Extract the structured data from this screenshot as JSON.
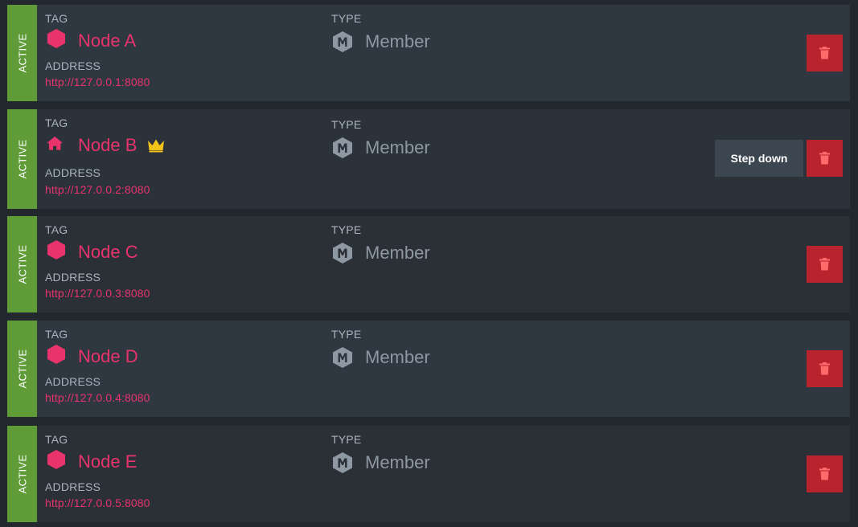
{
  "labels": {
    "tag": "TAG",
    "type": "TYPE",
    "address": "ADDRESS"
  },
  "nodes": [
    {
      "state": "ACTIVE",
      "tag_icon": "hexagon-icon",
      "name": "Node A",
      "leader": false,
      "type": "Member",
      "type_icon": "member-hexagon-icon",
      "address": "http://127.0.0.1:8080"
    },
    {
      "state": "ACTIVE",
      "tag_icon": "home-icon",
      "name": "Node B",
      "leader": true,
      "leader_icon": "crown-icon",
      "type": "Member",
      "type_icon": "member-hexagon-icon",
      "address": "http://127.0.0.2:8080",
      "step_down_label": "Step down"
    },
    {
      "state": "ACTIVE",
      "tag_icon": "hexagon-icon",
      "name": "Node C",
      "leader": false,
      "type": "Member",
      "type_icon": "member-hexagon-icon",
      "address": "http://127.0.0.3:8080"
    },
    {
      "state": "ACTIVE",
      "tag_icon": "hexagon-icon",
      "name": "Node D",
      "leader": false,
      "type": "Member",
      "type_icon": "member-hexagon-icon",
      "address": "http://127.0.0.4:8080"
    },
    {
      "state": "ACTIVE",
      "tag_icon": "hexagon-icon",
      "name": "Node E",
      "leader": false,
      "type": "Member",
      "type_icon": "member-hexagon-icon",
      "address": "http://127.0.0.5:8080"
    }
  ],
  "delete_icon": "trash-icon",
  "colors": {
    "active": "#5f9c37",
    "accent": "#e8336c",
    "delete": "#b8232e",
    "crown": "#f2c218"
  }
}
